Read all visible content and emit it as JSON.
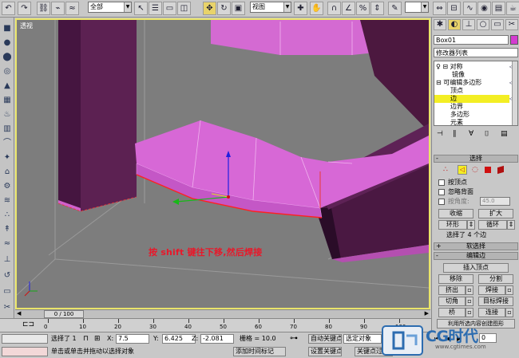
{
  "toolbar": {
    "selection_filter": "全部",
    "ref_coord": "视图"
  },
  "viewport": {
    "label": "透视",
    "annotation": "按 shift 键往下移,然后焊接"
  },
  "panel": {
    "object_name": "Box01",
    "modifier_list": "修改器列表",
    "stack": [
      "对称",
      "镜像",
      "可编辑多边形",
      "顶点",
      "边",
      "边界",
      "多边形",
      "元素"
    ],
    "selection_title": "选择",
    "by_vertex": "按顶点",
    "ignore_backfacing": "忽略背面",
    "by_angle": "按角度:",
    "angle_value": "45.0",
    "shrink": "收缩",
    "grow": "扩大",
    "ring": "环形",
    "loop": "循环",
    "selected_info": "选择了 4 个边",
    "soft_selection": "软选择",
    "edit_edges": "编辑边",
    "insert_vertex": "插入顶点",
    "remove": "移除",
    "split": "分割",
    "extrude": "挤出",
    "weld": "焊接",
    "chamfer": "切角",
    "target_weld": "目标焊接",
    "bridge": "桥",
    "connect": "连接",
    "create_shape": "利用所选内容创建图形"
  },
  "timeline": {
    "frame_counter": "0 / 100",
    "ticks": [
      "0",
      "10",
      "20",
      "30",
      "40",
      "50",
      "60",
      "70",
      "80",
      "90",
      "100"
    ]
  },
  "status": {
    "selected": "选择了 1",
    "x_label": "X:",
    "x_value": "7.5",
    "y_label": "Y:",
    "y_value": "6.425",
    "z_label": "Z:",
    "z_value": "-2.081",
    "grid_label": "栅格 = 10.0",
    "auto_key": "自动关键点",
    "selected_obj": "选定对象",
    "set_key": "设置关键点",
    "key_filter": "关键点过滤器",
    "prompt": "单击或单击并拖动以选择对象",
    "add_time_tag": "添加时间标记"
  },
  "playback": {
    "frame": "0"
  },
  "logo": {
    "text": "CG时代",
    "url": "www.cgtimes.com"
  },
  "colors": {
    "viewport_bg": "#7d7d7d",
    "active_border": "#e9e46a",
    "mesh_magenta": "#d25fd6",
    "mesh_dark": "#5a1f4e",
    "annotation_red": "#e8182a",
    "highlight_yellow": "#f3ee24"
  }
}
